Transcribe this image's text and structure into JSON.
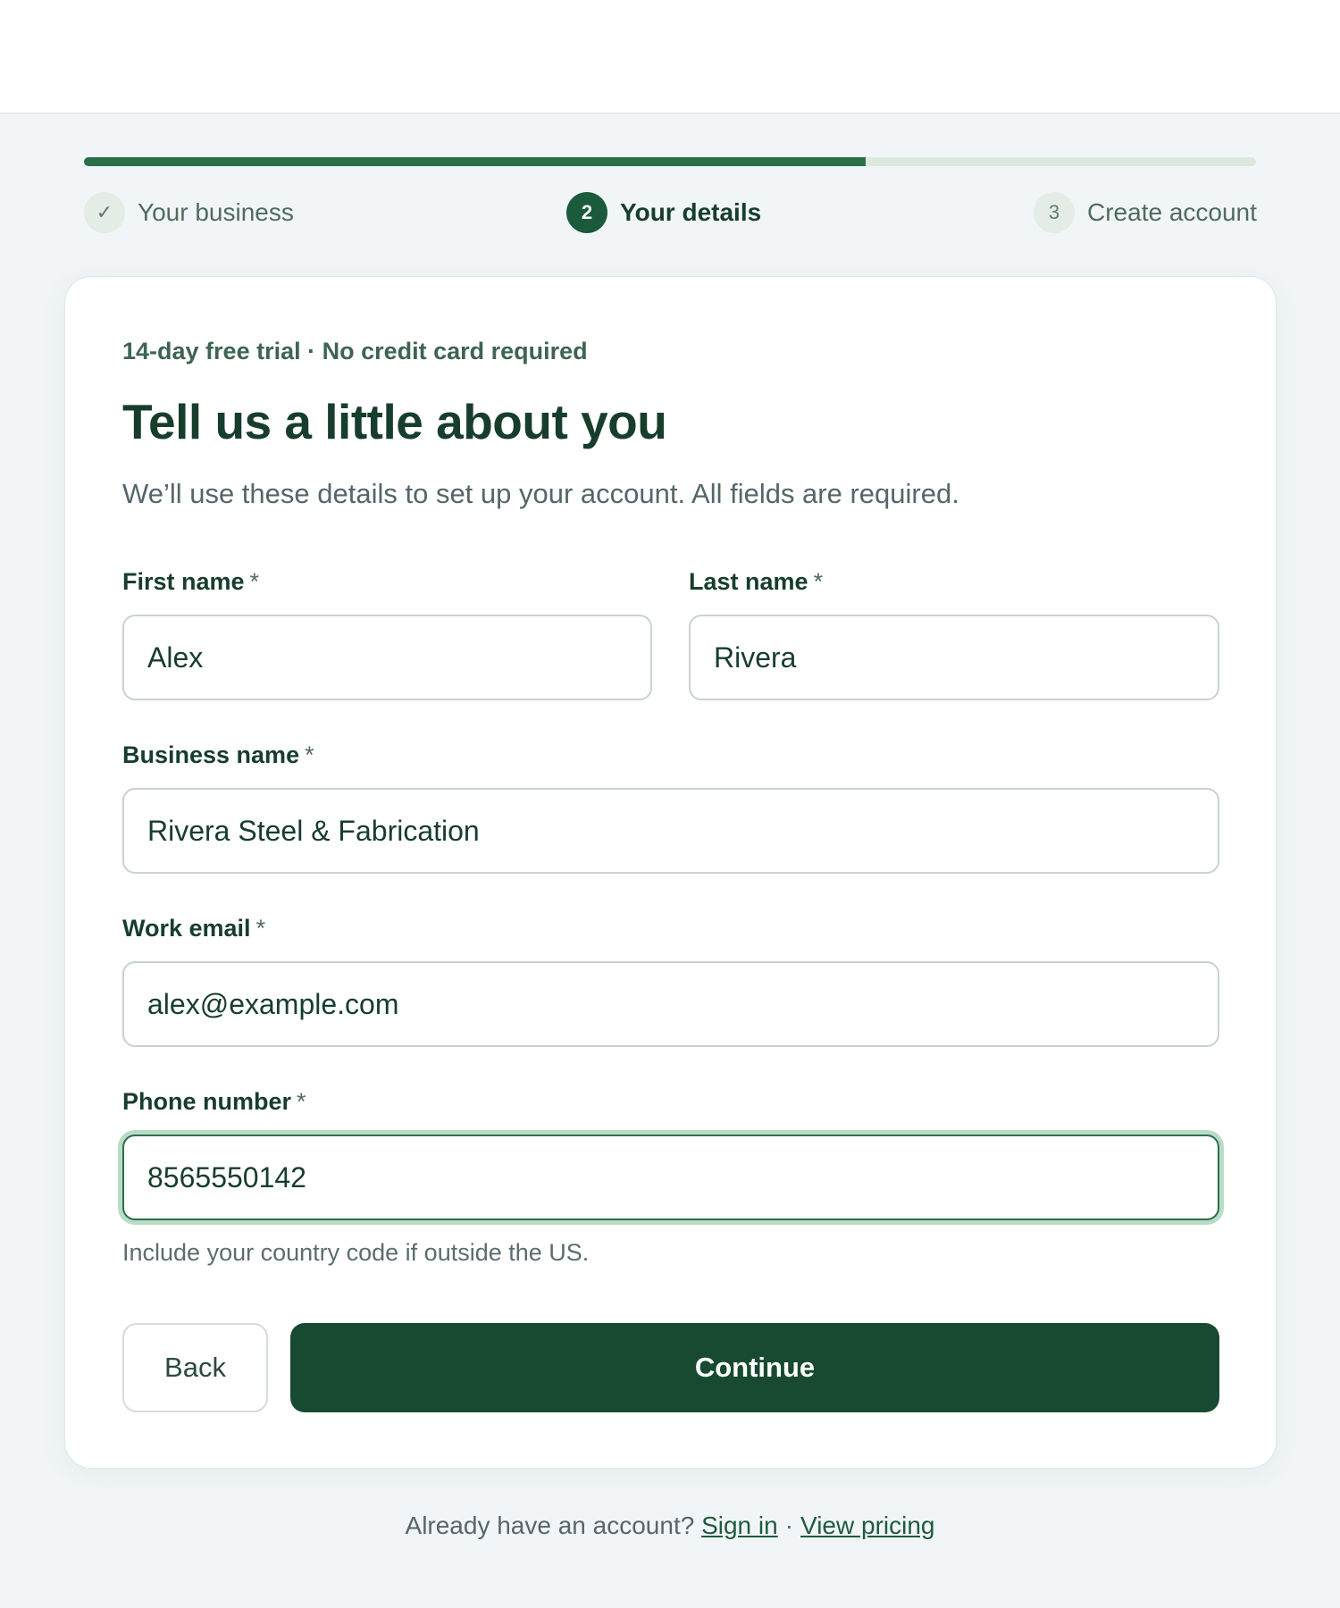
{
  "progress": {
    "fraction": 0.667
  },
  "steps": [
    {
      "number": "✓",
      "label": "Your business",
      "state": "done"
    },
    {
      "number": "2",
      "label": "Your details",
      "state": "active"
    },
    {
      "number": "3",
      "label": "Create account",
      "state": "todo"
    }
  ],
  "card": {
    "eyebrow": "14-day free trial · No credit card required",
    "title": "Tell us a little about you",
    "subtitle": "We’ll use these details to set up your account. All fields are required."
  },
  "form": {
    "required_marker": "*",
    "first_name": {
      "label": "First name",
      "value": "Alex"
    },
    "last_name": {
      "label": "Last name",
      "value": "Rivera"
    },
    "business_name": {
      "label": "Business name",
      "value": "Rivera Steel & Fabrication"
    },
    "work_email": {
      "label": "Work email",
      "value": "alex@example.com"
    },
    "phone": {
      "label": "Phone number",
      "value": "8565550142",
      "hint": "Include your country code if outside the US."
    }
  },
  "buttons": {
    "back": "Back",
    "continue": "Continue"
  },
  "footer": {
    "prompt": "Already have an account?",
    "sign_in": "Sign in",
    "separator": "·",
    "view_pricing": "View pricing"
  },
  "colors": {
    "accent": "#184a31",
    "progress": "#2b6e4a",
    "background": "#f1f5f7"
  }
}
